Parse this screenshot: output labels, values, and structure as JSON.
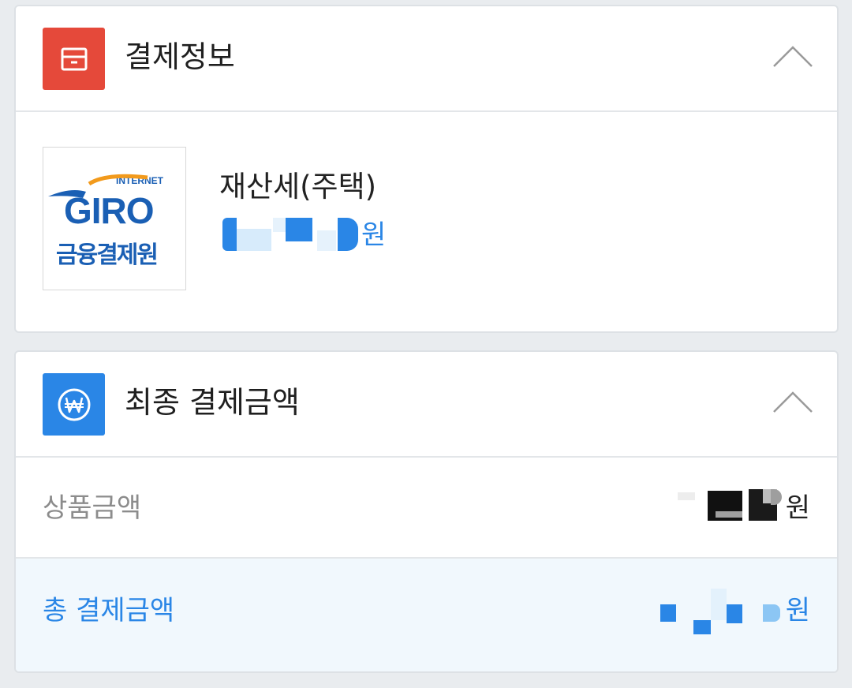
{
  "payment_info": {
    "title": "결제정보",
    "icon": "box-icon",
    "icon_color": "#e5493a",
    "item": {
      "logo": {
        "line1": "INTERNET",
        "line2": "GIRO",
        "line3": "금융결제원"
      },
      "name": "재산세(주택)",
      "price_unit": "원"
    }
  },
  "final_amount": {
    "title": "최종 결제금액",
    "icon": "won-icon",
    "icon_color": "#2a86e6",
    "rows": {
      "product": {
        "label": "상품금액",
        "unit": "원"
      },
      "total": {
        "label": "총 결제금액",
        "unit": "원"
      }
    }
  },
  "colors": {
    "accent_blue": "#2a86e6",
    "accent_red": "#e5493a",
    "total_row_bg": "#f1f8fd",
    "page_bg": "#e9ecef"
  }
}
